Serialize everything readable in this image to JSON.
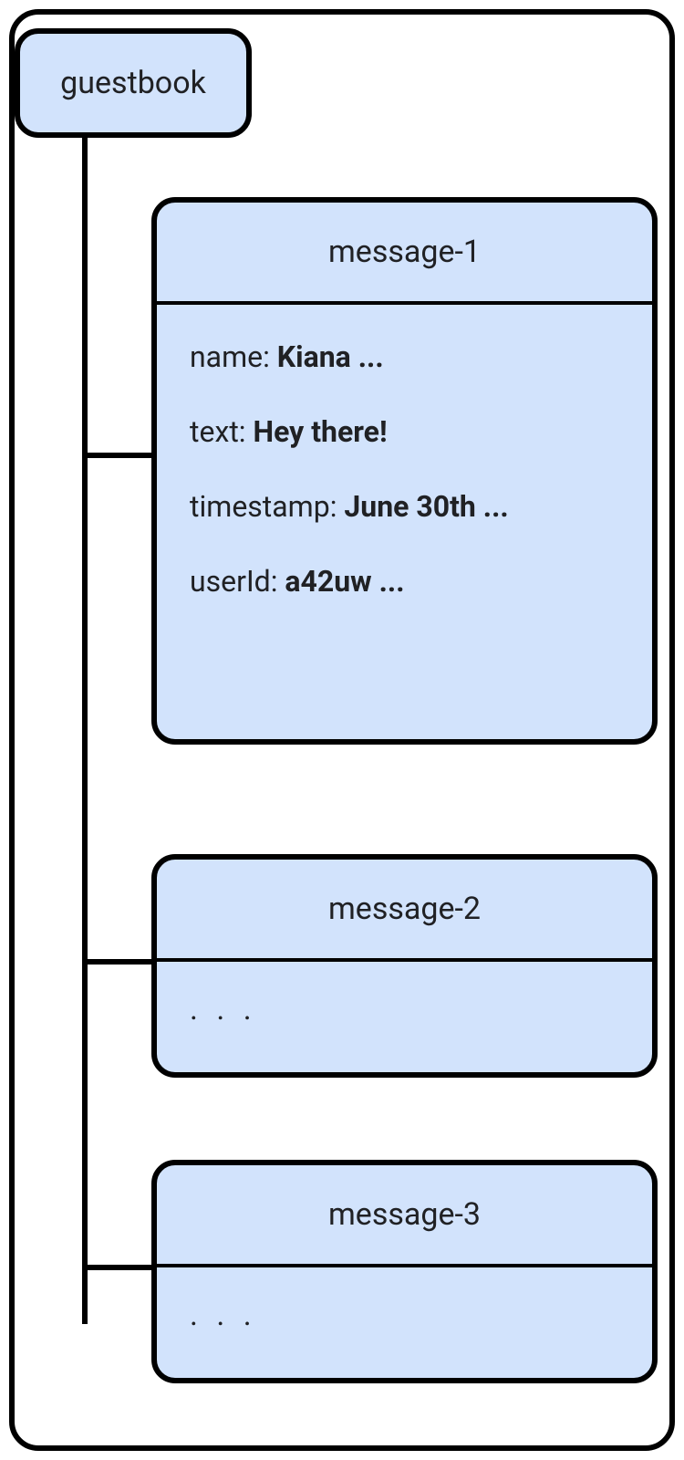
{
  "collection": {
    "name": "guestbook"
  },
  "documents": [
    {
      "id": "message-1",
      "fields": [
        {
          "key": "name",
          "value": "Kiana ..."
        },
        {
          "key": "text",
          "value": "Hey there!"
        },
        {
          "key": "timestamp",
          "value": "June 30th ..."
        },
        {
          "key": "userId",
          "value": "a42uw ..."
        }
      ]
    },
    {
      "id": "message-2",
      "ellipsis": ". . ."
    },
    {
      "id": "message-3",
      "ellipsis": ". . ."
    }
  ]
}
